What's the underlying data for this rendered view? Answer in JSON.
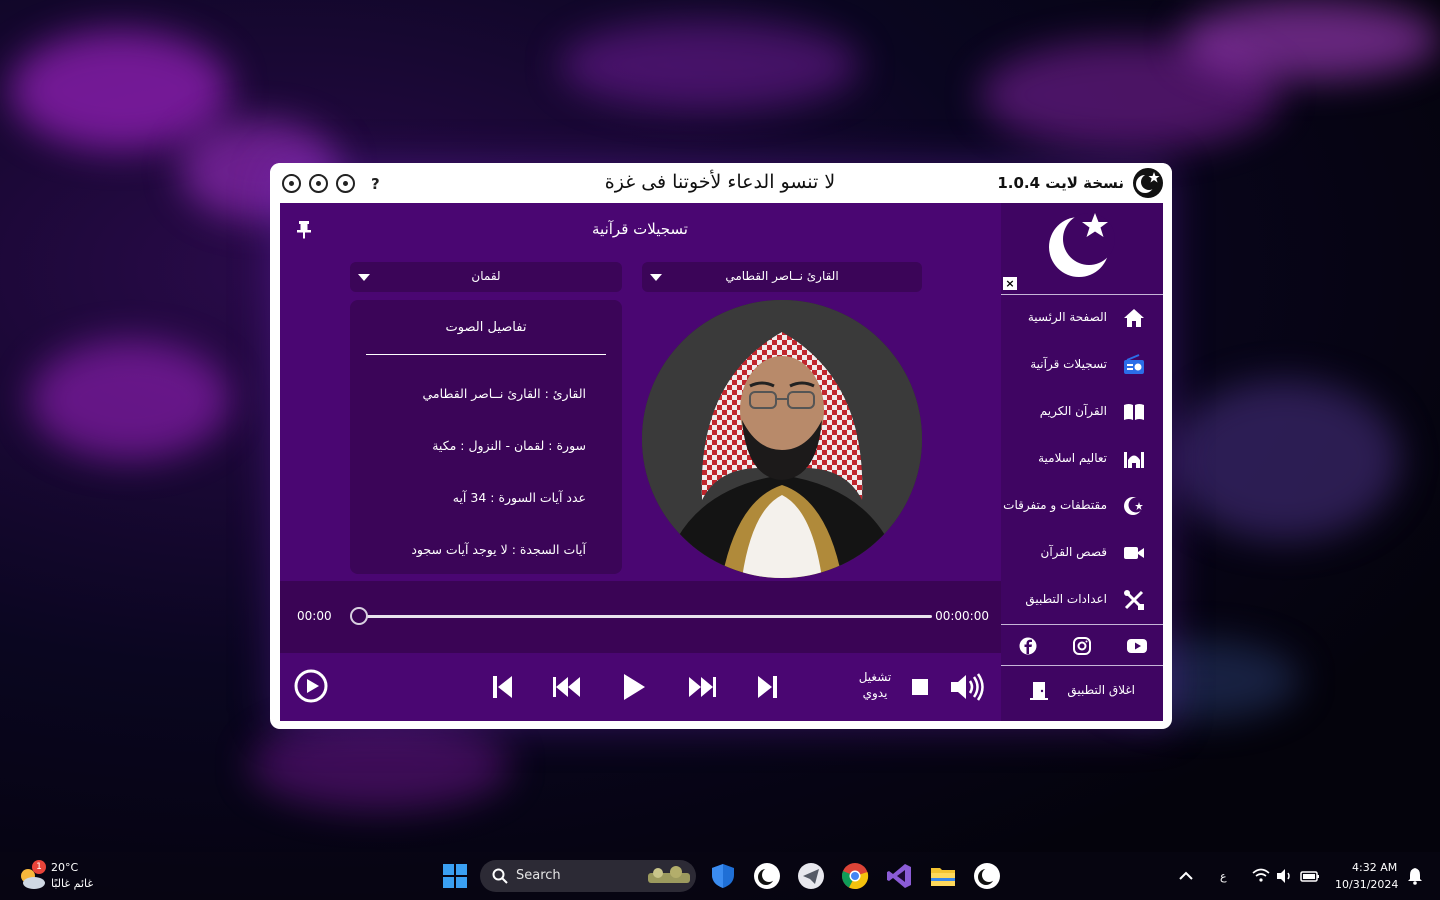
{
  "window": {
    "title": "لا تنسو الدعاء لأخوتنا فى غزة",
    "version": "1.0.4",
    "edition": "نسخة لايت",
    "help": "?"
  },
  "page": {
    "title": "تسجيلات قرآنية",
    "reciter_select": "القارئ نــاصر القطامي",
    "surah_select": "لقمان",
    "details_heading": "تفاصيل الصوت",
    "details": {
      "reciter": "القارئ : القارئ نــاصر القطامي",
      "surah": "سورة  :  لقمان  -  النزول  :  مكية",
      "ayah_count": "عدد آيات السورة :  34  آيه",
      "sajda": "آيات السجدة  :  لا يوجد آيات سجود"
    }
  },
  "player": {
    "current_time": "00:00",
    "total_time": "00:00:00",
    "progress": 0,
    "mode_line1": "تشغيل",
    "mode_line2": "يدوي"
  },
  "sidebar": {
    "close": "×",
    "items": [
      {
        "label": "الصفحة الرئسية",
        "icon": "home-icon"
      },
      {
        "label": "تسجيلات قرآنية",
        "icon": "radio-icon"
      },
      {
        "label": "القرآن الكريم",
        "icon": "book-icon"
      },
      {
        "label": "تعاليم اسلامية",
        "icon": "mosque-icon"
      },
      {
        "label": "مقتطفات و متفرقات",
        "icon": "crescent-icon"
      },
      {
        "label": "قصص القرآن",
        "icon": "video-icon"
      },
      {
        "label": "اعدادات التطبيق",
        "icon": "tools-icon"
      }
    ],
    "exit_label": "اغلاق التطبيق"
  },
  "taskbar": {
    "temperature": "20°C",
    "condition": "غائم غالبًا",
    "badge": "1",
    "search_label": "Search",
    "time": "4:32 AM",
    "date": "10/31/2024",
    "lang": "ع"
  },
  "colors": {
    "app_bg": "#4a0672",
    "panel_bg": "#3b0558",
    "accent_blue": "#2b6de8"
  }
}
